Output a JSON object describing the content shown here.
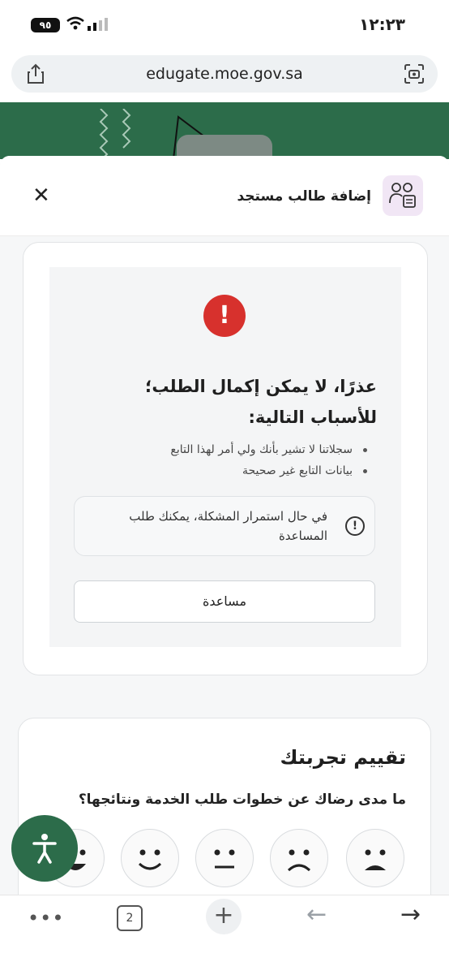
{
  "status_bar": {
    "time": "١٢:٢٣",
    "battery": "٩٥"
  },
  "browser": {
    "url": "edugate.moe.gov.sa",
    "tab_count": "2"
  },
  "sheet": {
    "title": "إضافة طالب مستجد",
    "error": {
      "title": "عذرًا، لا يمكن إكمال الطلب؛ للأسباب التالية:",
      "reasons": [
        "سجلاتنا لا تشير بأنك ولي أمر لهذا التابع",
        "بيانات التابع غير صحيحة"
      ],
      "note": "في حال استمرار المشكلة، يمكنك طلب المساعدة",
      "help_button": "مساعدة"
    },
    "rating": {
      "title": "تقييم تجربتك",
      "question": "ما مدى رضاك عن خطوات طلب الخدمة ونتائجها؟",
      "faces": [
        "very-sad-face-icon",
        "sad-face-icon",
        "neutral-face-icon",
        "happy-face-icon",
        "very-happy-face-icon"
      ]
    }
  },
  "colors": {
    "brand_green": "#2c6c4a",
    "error_red": "#d7312d"
  }
}
